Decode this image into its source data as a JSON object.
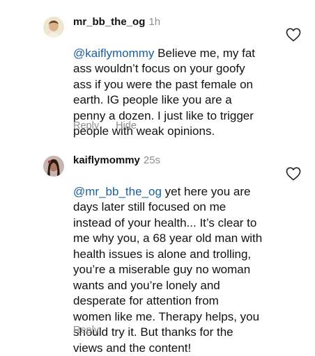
{
  "comments": [
    {
      "username": "mr_bb_the_og",
      "time": "1h",
      "mention": "@kaiflymommy",
      "lines": [
        "Believe me, my fat",
        "ass wouldn’t focus on your goofy",
        "ass if you were the past female on",
        "earth. IG people like you are a",
        "penny a dozen. I just like to trigger",
        "people with weak opinions."
      ],
      "reply_label": "Reply",
      "hide_label": "Hide",
      "avatar_icon": "profile-photo-avatar",
      "like_icon": "heart-outline-icon"
    },
    {
      "username": "kaiflymommy",
      "time": "25s",
      "mention": "@mr_bb_the_og",
      "lines": [
        "yet here you are",
        "days later still focused on me",
        "instead of your health... It’s clear to",
        "me why you, a 68 year old man with",
        "health issues is alone and trolling,",
        "you’re a miserable guy no woman",
        "wants and you’re lonely and",
        "desperate for attention from",
        "women like me. Therapy helps, you",
        "should try it. But thanks for the",
        "views and the content!"
      ],
      "reply_label": "Reply",
      "avatar_icon": "profile-photo-avatar",
      "like_icon": "heart-outline-icon"
    }
  ],
  "colors": {
    "text": "#111111",
    "secondary": "#8e8e8e",
    "mention": "#1a5fa0",
    "background": "#ffffff"
  }
}
